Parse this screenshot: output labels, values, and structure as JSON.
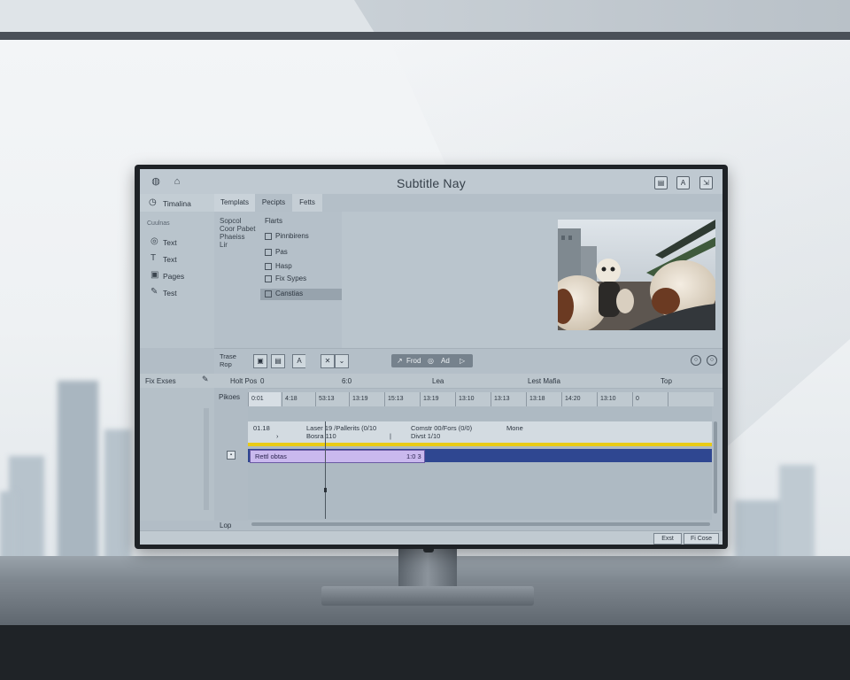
{
  "app": {
    "title": "Subtitle Nay"
  },
  "titlebar": {
    "left_icons": [
      "help-icon",
      "home-icon"
    ],
    "window_buttons": [
      "window-button-1",
      "window-button-2",
      "window-button-3"
    ],
    "window_button_glyphs": [
      "▤",
      "A",
      "⇲"
    ]
  },
  "sidebar": {
    "header_label": "Timalina",
    "section_label": "Cuulnas",
    "items": [
      {
        "label": "Text",
        "icon": "text-icon",
        "glyph": "◎"
      },
      {
        "label": "Text",
        "icon": "text-frame-icon",
        "glyph": "T"
      },
      {
        "label": "Pages",
        "icon": "pages-icon",
        "glyph": "▣"
      },
      {
        "label": "Test",
        "icon": "edit-icon",
        "glyph": "✎"
      }
    ]
  },
  "tabs": [
    {
      "label": "Templats"
    },
    {
      "label": "Pecipts"
    },
    {
      "label": "Fetts"
    }
  ],
  "browser": {
    "col1_lines": [
      "Sopcol",
      "Coor Pabet",
      "Phaeiss",
      "Lir"
    ],
    "col2_header": "Flarts",
    "presets": [
      {
        "label": "Pinnbirens"
      },
      {
        "label": "Pas"
      },
      {
        "label": "Hasp"
      },
      {
        "label": "Fix Sypes"
      },
      {
        "label": "Canstias"
      }
    ]
  },
  "transport": {
    "label_lines": [
      "Trase",
      "Rop"
    ],
    "tools": [
      "▣",
      "▤",
      "A",
      "✕",
      "⌄"
    ],
    "play_group": [
      "↗",
      "Frod",
      "◎",
      "Ad",
      "▷"
    ],
    "right_buttons": [
      "○",
      "○"
    ]
  },
  "timeline": {
    "ruler": {
      "left_label": "Fix Exses",
      "field1": "Holt Pos",
      "field1_value": "0",
      "field2": "6:0",
      "field3": "Lea",
      "field4": "Lest Mafia",
      "field5": "Top"
    },
    "gutter_label": "Pikoes",
    "footer_label": "Lop",
    "ticks": [
      "0:01",
      "4:18",
      "53:13",
      "13:19",
      "15:13",
      "13:19",
      "13:10",
      "13:13",
      "13:18",
      "14:20",
      "13:10",
      "0"
    ],
    "info": {
      "col1": [
        "01.18",
        "›"
      ],
      "col2": [
        "Laser  19 /Pallerits (0/10",
        "Bosra  110"
      ],
      "col3": [
        "Comstr 00/Fors (0/0)",
        "Divst  1/10"
      ],
      "col4": "Mone"
    },
    "clip": {
      "label": "Rettl obtas",
      "timecode": "1:0 3"
    }
  },
  "footer": {
    "buttons": [
      "Exst",
      "Fi Cose"
    ]
  },
  "colors": {
    "screen": "#b2bdc6",
    "yellow_track": "#e9cb16",
    "blue_track": "#2f4791",
    "clip_fill": "#cab9ee"
  }
}
